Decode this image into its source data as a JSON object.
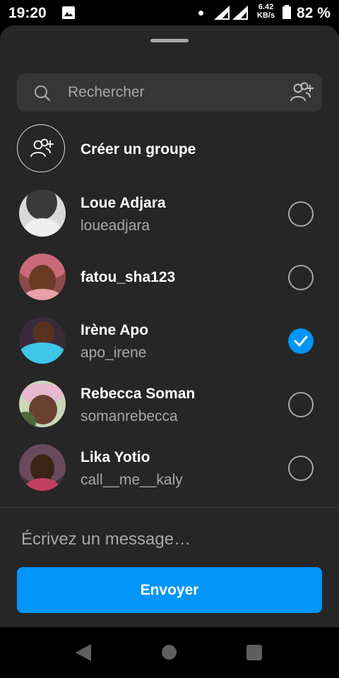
{
  "status_bar": {
    "time": "19:20",
    "speed_value": "6.42",
    "speed_unit": "KB/s",
    "battery": "82 %"
  },
  "search": {
    "placeholder": "Rechercher"
  },
  "create_group": {
    "label": "Créer un groupe"
  },
  "contacts": [
    {
      "name": "Loue Adjara",
      "username": "loueadjara",
      "selected": false
    },
    {
      "name": "fatou_sha123",
      "username": "",
      "selected": false
    },
    {
      "name": "Irène Apo",
      "username": "apo_irene",
      "selected": true
    },
    {
      "name": "Rebecca Soman",
      "username": "somanrebecca",
      "selected": false
    },
    {
      "name": "Lika Yotio",
      "username": "call__me__kaly",
      "selected": false
    }
  ],
  "composer": {
    "message_placeholder": "Écrivez un message…",
    "send_label": "Envoyer"
  },
  "colors": {
    "sheet_bg": "#262626",
    "accent": "#0095f6",
    "secondary_text": "#a8a8a8"
  }
}
